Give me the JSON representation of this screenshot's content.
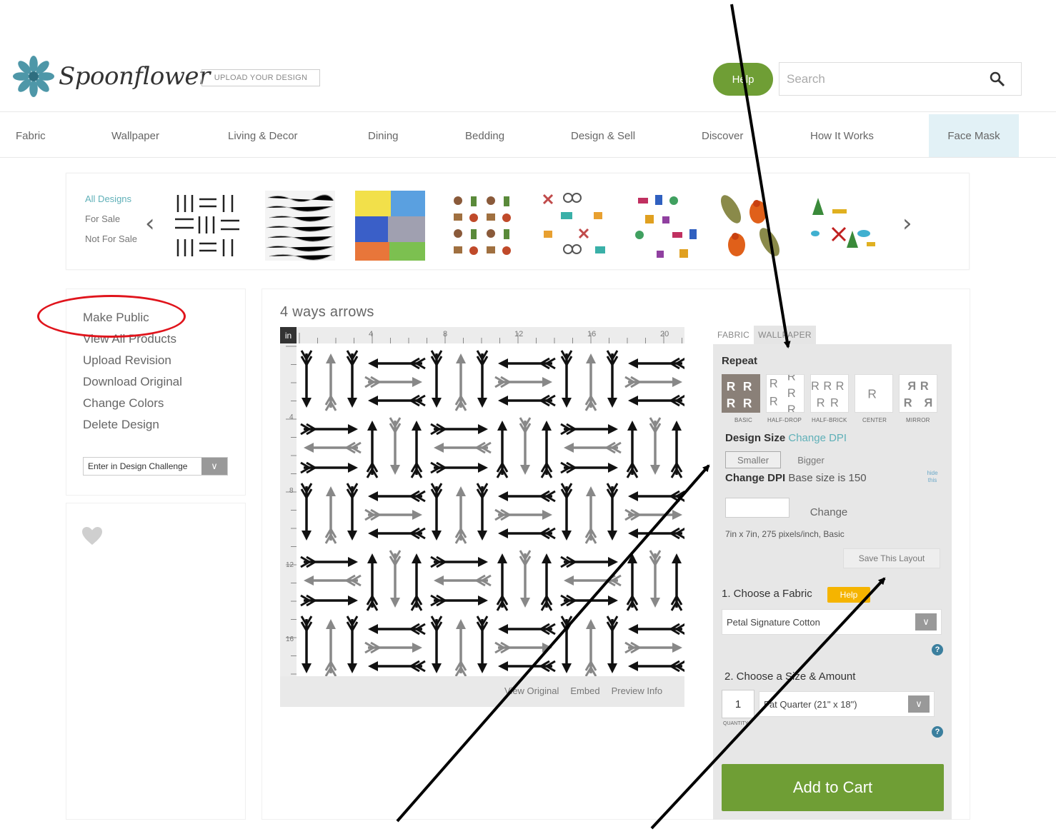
{
  "header": {
    "brand": "Spoonflower",
    "upload_label": "UPLOAD YOUR DESIGN",
    "help_label": "Help",
    "search_placeholder": "Search"
  },
  "nav": {
    "items": [
      {
        "label": "Fabric"
      },
      {
        "label": "Wallpaper"
      },
      {
        "label": "Living & Decor"
      },
      {
        "label": "Dining"
      },
      {
        "label": "Bedding"
      },
      {
        "label": "Design & Sell"
      },
      {
        "label": "Discover"
      },
      {
        "label": "How It Works"
      },
      {
        "label": "Face Mask"
      }
    ],
    "active": "Face Mask"
  },
  "carousel": {
    "filters": [
      "All Designs",
      "For Sale",
      "Not For Sale"
    ],
    "active_filter": "All Designs",
    "prev_icon": "chevron-left-icon",
    "next_icon": "chevron-right-icon"
  },
  "sidebar": {
    "links": [
      "Make Public",
      "View All Products",
      "Upload Revision",
      "Download Original",
      "Change Colors",
      "Delete Design"
    ],
    "challenge_label": "Enter in Design Challenge"
  },
  "design": {
    "title": "4 ways arrows",
    "unit": "in",
    "ruler_top": [
      "4",
      "8",
      "12",
      "16",
      "20"
    ],
    "ruler_left": [
      "4",
      "8",
      "12",
      "16"
    ],
    "links": [
      "View Original",
      "Embed",
      "Preview Info"
    ]
  },
  "config": {
    "tabs": [
      "FABRIC",
      "WALLPAPER"
    ],
    "repeat_title": "Repeat",
    "repeat_options": [
      "BASIC",
      "HALF-DROP",
      "HALF-BRICK",
      "CENTER",
      "MIRROR"
    ],
    "design_size_label": "Design Size",
    "change_dpi_link": "Change DPI",
    "smaller_label": "Smaller",
    "bigger_label": "Bigger",
    "change_dpi_bold": "Change DPI",
    "base_size_text": "Base size is 150",
    "hide_label": "hide this",
    "change_label": "Change",
    "size_info": "7in x 7in, 275 pixels/inch, Basic",
    "save_layout_label": "Save This Layout",
    "choose_fabric_title": "1. Choose a Fabric",
    "fabric_help": "Help",
    "fabric_selected": "Petal Signature Cotton",
    "choose_size_title": "2. Choose a Size & Amount",
    "quantity": "1",
    "quantity_label": "QUANTITY",
    "size_selected": "Fat Quarter (21\" x 18\")",
    "add_to_cart": "Add to Cart"
  },
  "colors": {
    "brand_green": "#6f9e35",
    "teal_link": "#5fb0b8",
    "annotation_red": "#e0141c",
    "help_yellow": "#f5b400"
  }
}
